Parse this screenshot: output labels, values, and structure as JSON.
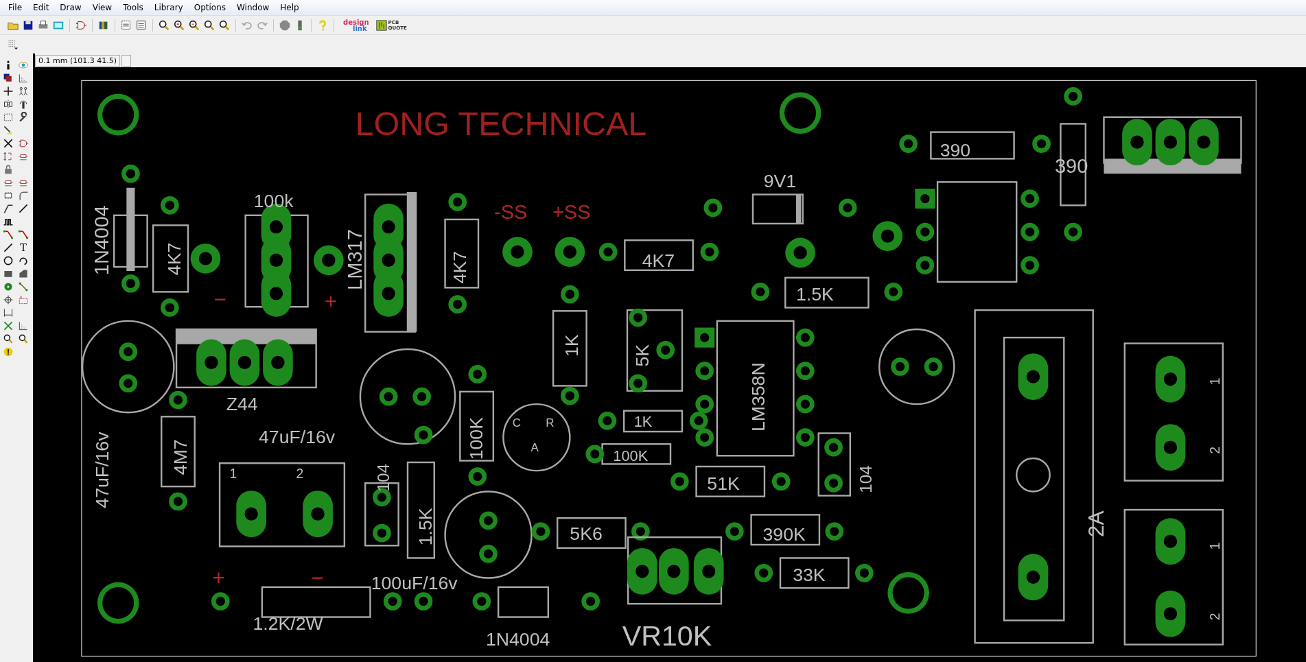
{
  "menu": [
    "File",
    "Edit",
    "Draw",
    "View",
    "Tools",
    "Library",
    "Options",
    "Window",
    "Help"
  ],
  "toolbar_logos": {
    "designlink": [
      "design",
      "link"
    ],
    "pcb_quote": [
      "PCB",
      "QUOTE"
    ]
  },
  "palette": {
    "text_tool": "T"
  },
  "coordinates": "0.1 mm (101.3 41.5)",
  "board": {
    "labels": [
      {
        "text": "LONG TECHNICAL",
        "kind": "title"
      },
      {
        "text": "100k",
        "kind": "value"
      },
      {
        "text": "1N4004",
        "kind": "value"
      },
      {
        "text": "4K7",
        "kind": "value"
      },
      {
        "text": "LM317",
        "kind": "value"
      },
      {
        "text": "4K7",
        "kind": "value"
      },
      {
        "text": "-SS",
        "kind": "net"
      },
      {
        "text": "+SS",
        "kind": "net"
      },
      {
        "text": "9V1",
        "kind": "value"
      },
      {
        "text": "390",
        "kind": "value"
      },
      {
        "text": "390",
        "kind": "value"
      },
      {
        "text": "4K7",
        "kind": "value"
      },
      {
        "text": "1.5K",
        "kind": "value"
      },
      {
        "text": "1K",
        "kind": "value"
      },
      {
        "text": "5K",
        "kind": "value"
      },
      {
        "text": "LM358N",
        "kind": "value"
      },
      {
        "text": "Z44",
        "kind": "value"
      },
      {
        "text": "47uF/16v",
        "kind": "value"
      },
      {
        "text": "47uF/16v",
        "kind": "value"
      },
      {
        "text": "4M7",
        "kind": "value"
      },
      {
        "text": "100K",
        "kind": "value"
      },
      {
        "text": "C",
        "kind": "pin"
      },
      {
        "text": "R",
        "kind": "pin"
      },
      {
        "text": "A",
        "kind": "pin"
      },
      {
        "text": "1K",
        "kind": "value"
      },
      {
        "text": "100K",
        "kind": "value"
      },
      {
        "text": "104",
        "kind": "value"
      },
      {
        "text": "1.5K",
        "kind": "value"
      },
      {
        "text": "51K",
        "kind": "value"
      },
      {
        "text": "104",
        "kind": "value"
      },
      {
        "text": "1",
        "kind": "pin"
      },
      {
        "text": "2",
        "kind": "pin"
      },
      {
        "text": "5K6",
        "kind": "value"
      },
      {
        "text": "390K",
        "kind": "value"
      },
      {
        "text": "33K",
        "kind": "value"
      },
      {
        "text": "2A",
        "kind": "value"
      },
      {
        "text": "1",
        "kind": "pin"
      },
      {
        "text": "2",
        "kind": "pin"
      },
      {
        "text": "1",
        "kind": "pin"
      },
      {
        "text": "2",
        "kind": "pin"
      },
      {
        "text": "100uF/16v",
        "kind": "value"
      },
      {
        "text": "1.2K/2W",
        "kind": "value"
      },
      {
        "text": "1N4004",
        "kind": "value"
      },
      {
        "text": "VR10K",
        "kind": "value"
      },
      {
        "text": "+",
        "kind": "net"
      },
      {
        "text": "−",
        "kind": "net"
      },
      {
        "text": "−",
        "kind": "net"
      },
      {
        "text": "+",
        "kind": "net"
      }
    ]
  }
}
